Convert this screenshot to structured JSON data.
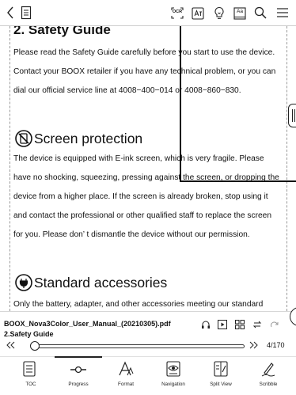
{
  "toolbar": {
    "back_icon": "chevron-left-icon",
    "menu_icon": "book-icon",
    "ocr_label": "OCR",
    "aa_label": "Aa",
    "right_icons": [
      "ocr-icon",
      "translate-icon",
      "bulb-icon",
      "font-aa-icon",
      "search-icon",
      "hamburger-menu-icon"
    ]
  },
  "document": {
    "safety_heading": "2.  Safety Guide",
    "safety_paragraph": [
      "Please read the Safety Guide carefully before you start to use the device.",
      "Contact your BOOX retailer if you have any technical problem, or you can",
      "dial our official service line at 4008−400−014 or 4008−860−830."
    ],
    "screen_heading": "Screen protection",
    "screen_paragraph": [
      "The device is equipped with E-ink screen, which is very fragile. Please",
      "have no shocking, squeezing, pressing against the screen, or dropping the",
      "device from a higher place. If the screen is already broken, stop using it",
      "and contact the professional or other qualified staff to replace the screen",
      "for you. Please don’ t dismantle the device without our permission."
    ],
    "accessories_heading": "Standard accessories",
    "accessories_paragraph": [
      "Only the battery, adapter, and other accessories meeting our standard"
    ]
  },
  "bottom_panel": {
    "file_name": "BOOX_Nova3Color_User_Manual_(20210305).pdf",
    "chapter": "2.Safety Guide",
    "page_indicator": "4/170",
    "progress_fraction": 0.02,
    "tools": [
      {
        "label": "TOC",
        "icon": "list-icon"
      },
      {
        "label": "Progress",
        "icon": "progress-slider-icon"
      },
      {
        "label": "Format",
        "icon": "format-a-icon"
      },
      {
        "label": "Navigation",
        "icon": "navigation-eye-icon"
      },
      {
        "label": "Split View",
        "icon": "split-view-icon"
      },
      {
        "label": "Scribble",
        "icon": "scribble-pen-icon"
      }
    ],
    "active_tool": "Progress"
  }
}
